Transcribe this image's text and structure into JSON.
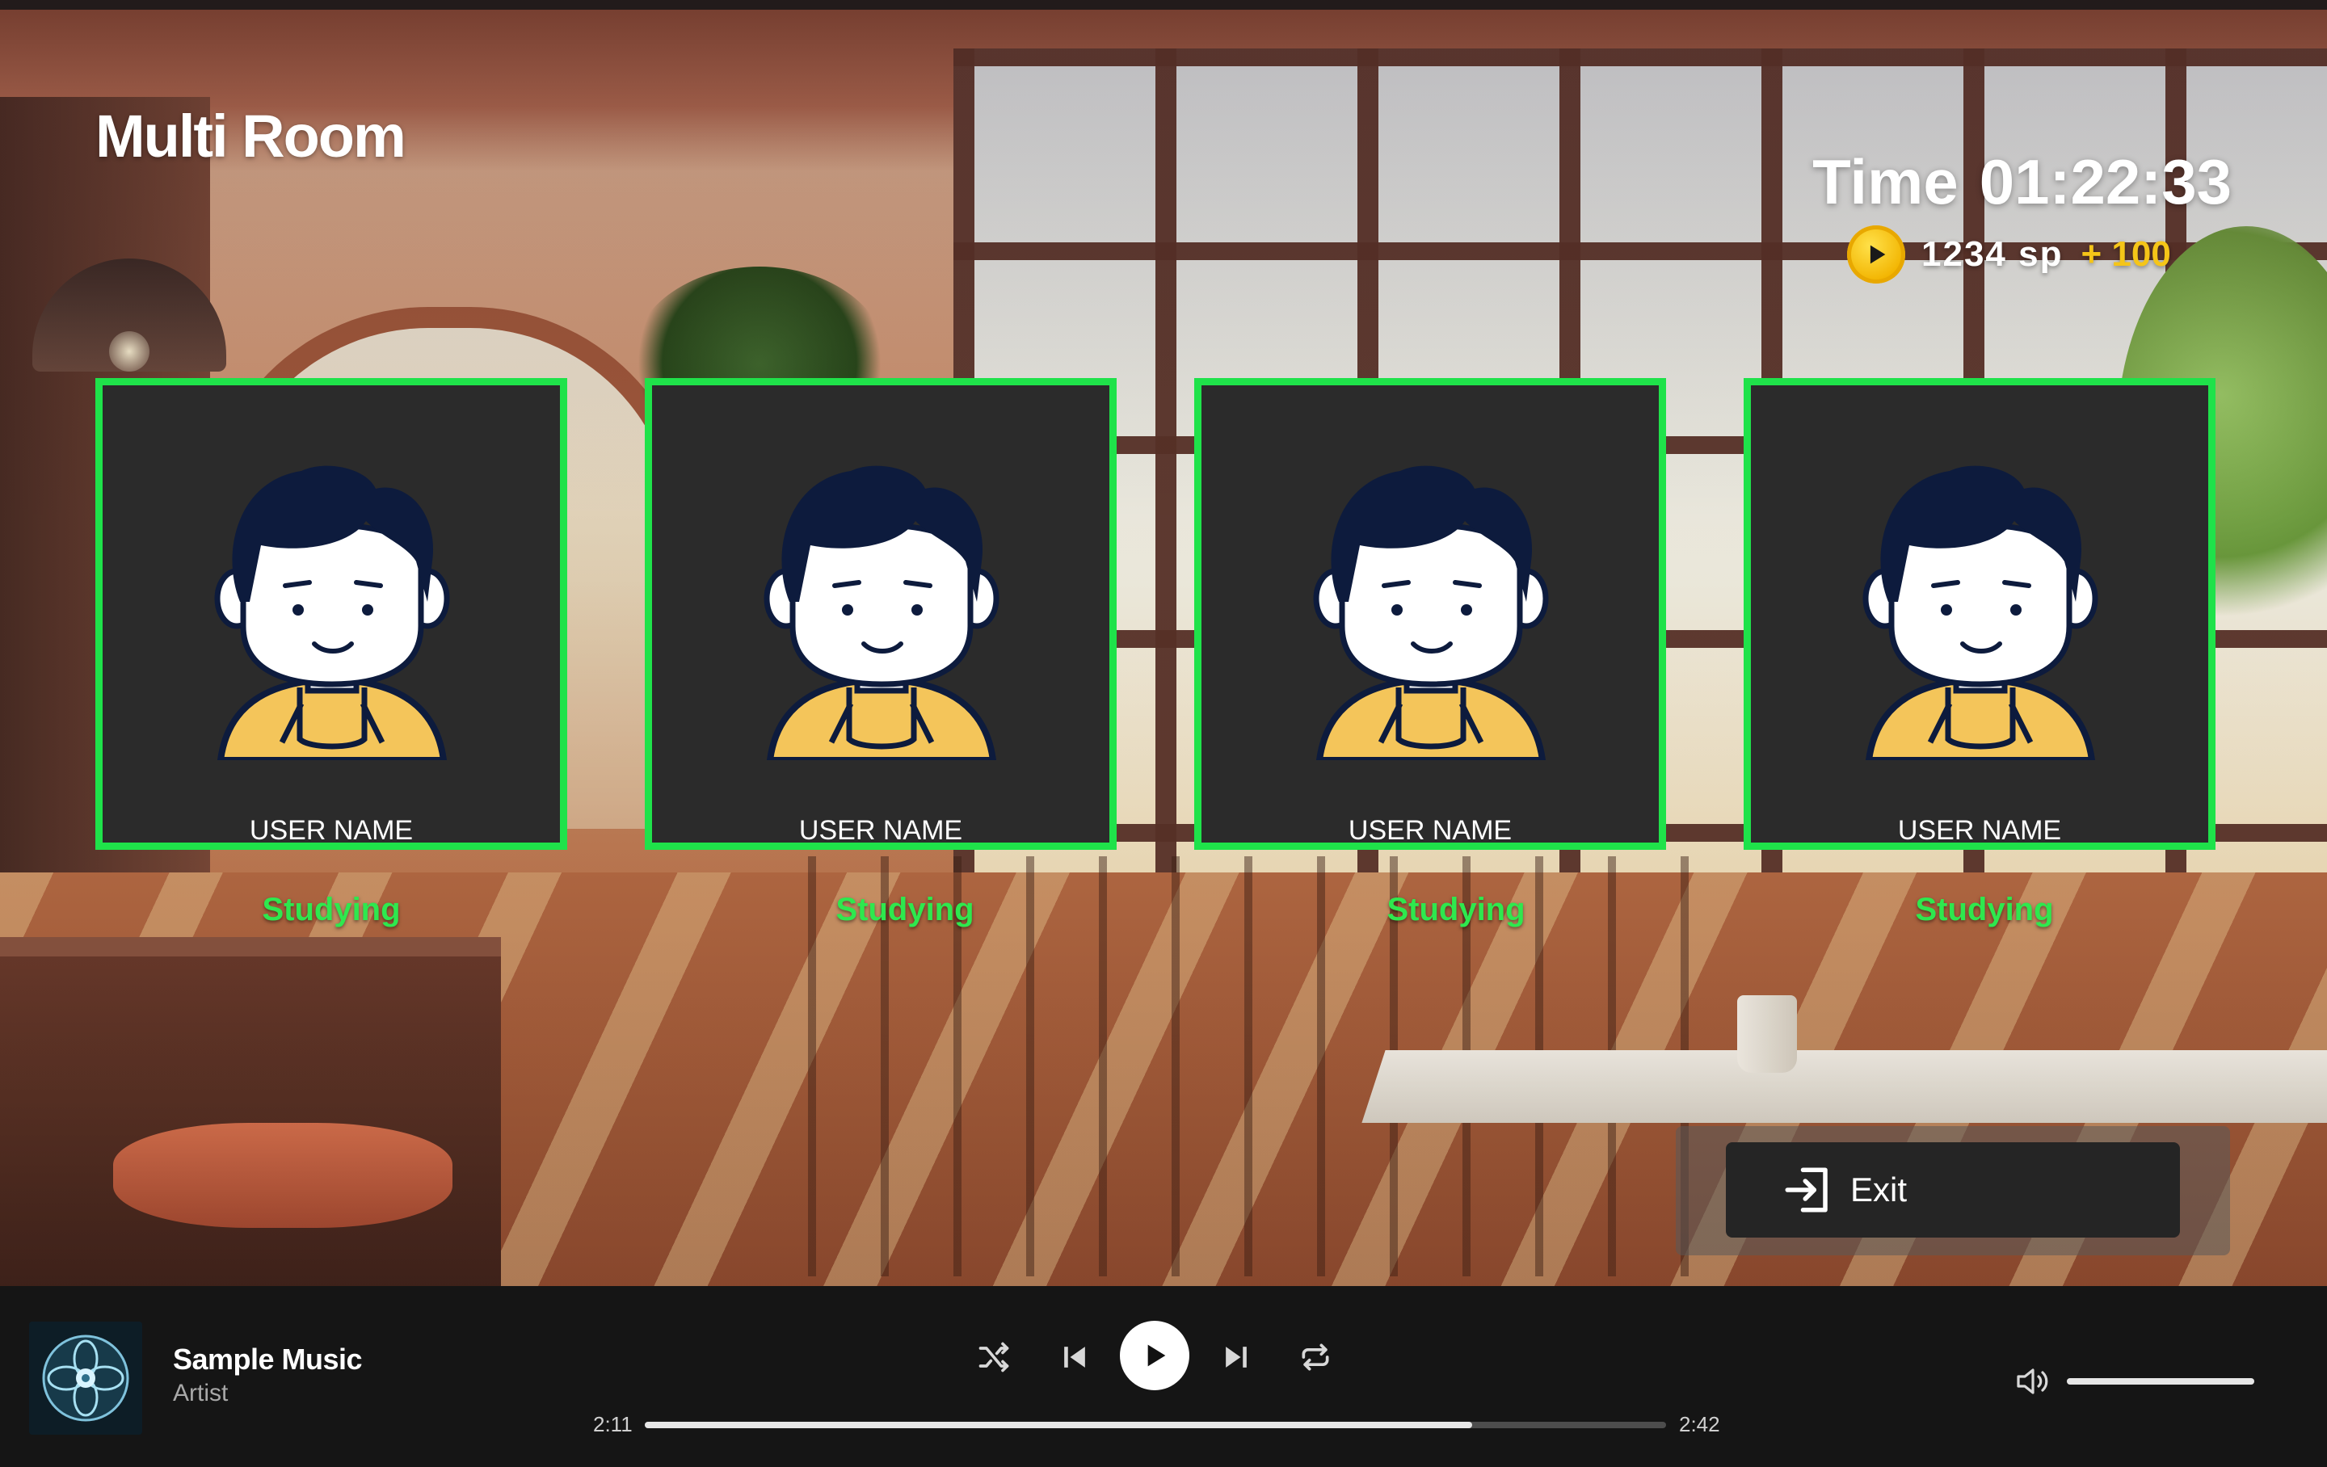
{
  "room": {
    "title": "Multi Room"
  },
  "timer": {
    "label": "Time",
    "value": "01:22:33"
  },
  "points": {
    "icon": "coin-play-icon",
    "amount": "1234 sp",
    "bonus": "+ 100"
  },
  "members": [
    {
      "name": "USER NAME",
      "status": "Studying"
    },
    {
      "name": "USER NAME",
      "status": "Studying"
    },
    {
      "name": "USER NAME",
      "status": "Studying"
    },
    {
      "name": "USER NAME",
      "status": "Studying"
    }
  ],
  "exit": {
    "label": "Exit",
    "icon": "exit-icon"
  },
  "player": {
    "title": "Sample Music",
    "artist": "Artist",
    "current_time": "2:11",
    "total_time": "2:42",
    "progress": 0.81,
    "volume": 1.0,
    "icons": {
      "shuffle": "shuffle-icon",
      "previous": "skip-previous-icon",
      "play": "play-icon",
      "next": "skip-next-icon",
      "repeat": "repeat-icon",
      "volume": "volume-icon"
    }
  },
  "colors": {
    "accent_green": "#1fe24a",
    "status_green": "#2ee84e",
    "bonus_gold": "#f5c518",
    "card_bg": "#2b2b2b",
    "player_bg": "#151515"
  }
}
